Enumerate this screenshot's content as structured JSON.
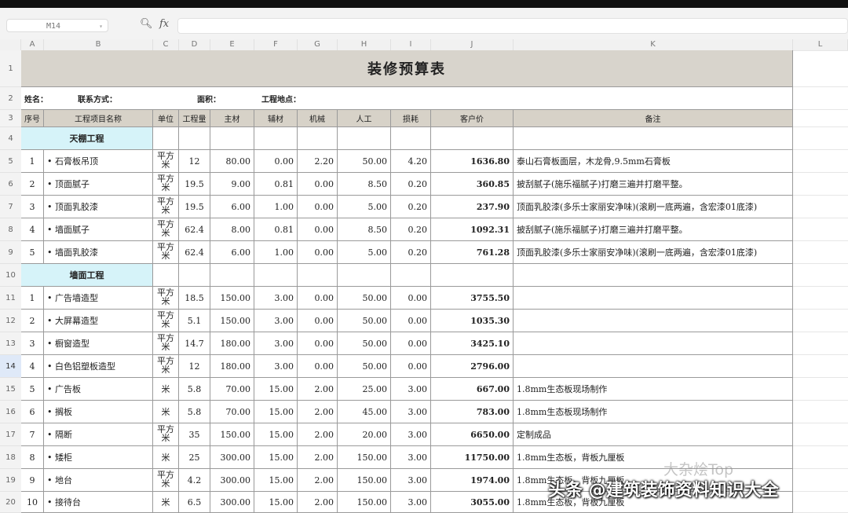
{
  "formula_bar": {
    "cell_ref": "M14",
    "fx_label": "fx",
    "search_icon": "zoom-icon"
  },
  "columns": [
    "A",
    "B",
    "C",
    "D",
    "E",
    "F",
    "G",
    "H",
    "I",
    "J",
    "K",
    "L"
  ],
  "row_numbers": [
    "1",
    "2",
    "3",
    "4",
    "5",
    "6",
    "7",
    "8",
    "9",
    "10",
    "11",
    "12",
    "13",
    "14",
    "15",
    "16",
    "17",
    "18",
    "19",
    "20"
  ],
  "active_row": "14",
  "sheet": {
    "title": "装修预算表",
    "info": {
      "name": "姓名：",
      "contact": "联系方式：",
      "area": "面积：",
      "location": "工程地点："
    },
    "headers": [
      "序号",
      "工程项目名称",
      "单位",
      "工程量",
      "主材",
      "辅材",
      "机械",
      "人工",
      "损耗",
      "客户价",
      "备注"
    ],
    "categories": {
      "ceiling": "天棚工程",
      "wall": "墙面工程"
    },
    "ceiling_items": [
      {
        "no": "1",
        "name": "• 石膏板吊顶",
        "unit": "平方米",
        "qty": "12",
        "main": "80.00",
        "aux": "0.00",
        "mech": "2.20",
        "labor": "50.00",
        "loss": "4.20",
        "price": "1636.80",
        "note": "泰山石膏板面层，木龙骨,9.5mm石膏板"
      },
      {
        "no": "2",
        "name": "• 顶面腻子",
        "unit": "平方米",
        "qty": "19.5",
        "main": "9.00",
        "aux": "0.81",
        "mech": "0.00",
        "labor": "8.50",
        "loss": "0.20",
        "price": "360.85",
        "note": "披刮腻子(施乐福腻子)打磨三遍并打磨平整。"
      },
      {
        "no": "3",
        "name": "• 顶面乳胶漆",
        "unit": "平方米",
        "qty": "19.5",
        "main": "6.00",
        "aux": "1.00",
        "mech": "0.00",
        "labor": "5.00",
        "loss": "0.20",
        "price": "237.90",
        "note": "顶面乳胶漆(多乐士家丽安净味)(滚刷一底两遍，含宏漆01底漆)"
      },
      {
        "no": "4",
        "name": "• 墙面腻子",
        "unit": "平方米",
        "qty": "62.4",
        "main": "8.00",
        "aux": "0.81",
        "mech": "0.00",
        "labor": "8.50",
        "loss": "0.20",
        "price": "1092.31",
        "note": "披刮腻子(施乐福腻子)打磨三遍并打磨平整。"
      },
      {
        "no": "5",
        "name": "• 墙面乳胶漆",
        "unit": "平方米",
        "qty": "62.4",
        "main": "6.00",
        "aux": "1.00",
        "mech": "0.00",
        "labor": "5.00",
        "loss": "0.20",
        "price": "761.28",
        "note": "顶面乳胶漆(多乐士家丽安净味)(滚刷一底两遍，含宏漆01底漆)"
      }
    ],
    "wall_items": [
      {
        "no": "1",
        "name": "• 广告墙造型",
        "unit": "平方米",
        "qty": "18.5",
        "main": "150.00",
        "aux": "3.00",
        "mech": "0.00",
        "labor": "50.00",
        "loss": "0.00",
        "price": "3755.50",
        "note": ""
      },
      {
        "no": "2",
        "name": "• 大屏幕造型",
        "unit": "平方米",
        "qty": "5.1",
        "main": "150.00",
        "aux": "3.00",
        "mech": "0.00",
        "labor": "50.00",
        "loss": "0.00",
        "price": "1035.30",
        "note": ""
      },
      {
        "no": "3",
        "name": "• 橱窗造型",
        "unit": "平方米",
        "qty": "14.7",
        "main": "180.00",
        "aux": "3.00",
        "mech": "0.00",
        "labor": "50.00",
        "loss": "0.00",
        "price": "3425.10",
        "note": ""
      },
      {
        "no": "4",
        "name": "• 白色铝塑板造型",
        "unit": "平方米",
        "qty": "12",
        "main": "180.00",
        "aux": "3.00",
        "mech": "0.00",
        "labor": "50.00",
        "loss": "0.00",
        "price": "2796.00",
        "note": ""
      },
      {
        "no": "5",
        "name": "• 广告板",
        "unit": "米",
        "qty": "5.8",
        "main": "70.00",
        "aux": "15.00",
        "mech": "2.00",
        "labor": "25.00",
        "loss": "3.00",
        "price": "667.00",
        "note": "1.8mm生态板现场制作"
      },
      {
        "no": "6",
        "name": "• 搁板",
        "unit": "米",
        "qty": "5.8",
        "main": "70.00",
        "aux": "15.00",
        "mech": "2.00",
        "labor": "45.00",
        "loss": "3.00",
        "price": "783.00",
        "note": "1.8mm生态板现场制作"
      },
      {
        "no": "7",
        "name": "• 隔断",
        "unit": "平方米",
        "qty": "35",
        "main": "150.00",
        "aux": "15.00",
        "mech": "2.00",
        "labor": "20.00",
        "loss": "3.00",
        "price": "6650.00",
        "note": "定制成品"
      },
      {
        "no": "8",
        "name": "• 矮柜",
        "unit": "米",
        "qty": "25",
        "main": "300.00",
        "aux": "15.00",
        "mech": "2.00",
        "labor": "150.00",
        "loss": "3.00",
        "price": "11750.00",
        "note": "1.8mm生态板，背板九厘板"
      },
      {
        "no": "9",
        "name": "• 地台",
        "unit": "平方米",
        "qty": "4.2",
        "main": "300.00",
        "aux": "15.00",
        "mech": "2.00",
        "labor": "150.00",
        "loss": "3.00",
        "price": "1974.00",
        "note": "1.8mm生态板，背板九厘板"
      },
      {
        "no": "10",
        "name": "• 接待台",
        "unit": "米",
        "qty": "6.5",
        "main": "300.00",
        "aux": "15.00",
        "mech": "2.00",
        "labor": "150.00",
        "loss": "3.00",
        "price": "3055.00",
        "note": "1.8mm生态板，背板九厘板"
      }
    ]
  },
  "watermark": {
    "logo_text": "大杂烩Top",
    "text": "头条 @建筑装饰资料知识大全"
  }
}
